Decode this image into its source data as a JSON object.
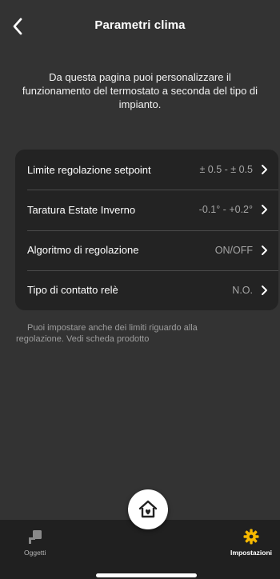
{
  "header": {
    "title": "Parametri clima"
  },
  "intro": {
    "line1": "Da questa pagina puoi personalizzare il",
    "line2": "funzionamento del termostato a seconda del tipo di",
    "line3": "impianto."
  },
  "settings": [
    {
      "label": "Limite regolazione setpoint",
      "value": "± 0.5 - ± 0.5"
    },
    {
      "label": "Taratura Estate Inverno",
      "value": "-0.1° - +0.2°"
    },
    {
      "label": "Algoritmo di regolazione",
      "value": "ON/OFF"
    },
    {
      "label": "Tipo di contatto relè",
      "value": "N.O."
    }
  ],
  "note": {
    "line1": "Puoi impostare anche dei limiti riguardo alla",
    "line2": "regolazione. Vedi scheda prodotto"
  },
  "tabbar": {
    "left_label": "Oggetti",
    "right_label": "Impostazioni",
    "active_color": "#f5b800"
  }
}
